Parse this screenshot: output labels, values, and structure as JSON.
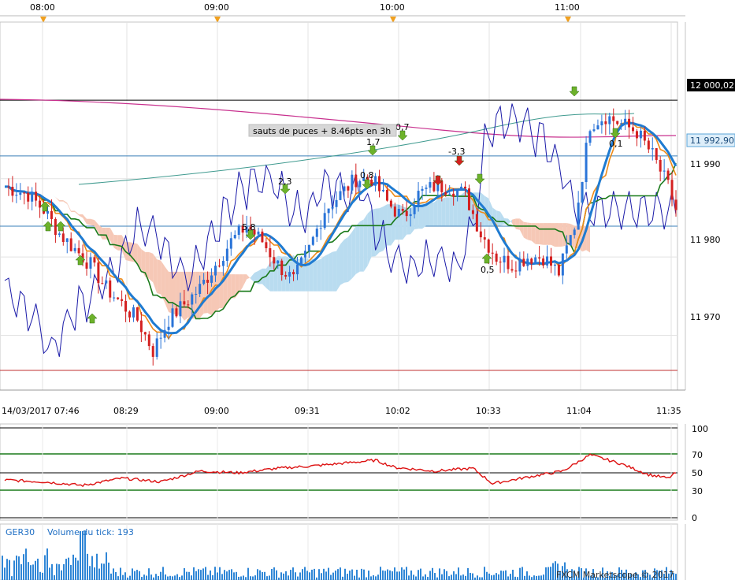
{
  "top_times": [
    "08:00",
    "09:00",
    "10:00",
    "11:00"
  ],
  "colors": {
    "candle_up": "#2a74d8",
    "candle_down": "#d42020",
    "cloud_bull": "#b9dcf0",
    "cloud_bear": "#f6c8b6",
    "sma_blue": "#1f7bd1",
    "tenkan": "#ee8a17",
    "kijun": "#1a7a1a",
    "magenta": "#c8308e",
    "teal": "#3f9a8f",
    "chikou": "#1a1aa8",
    "rsi": "#dd1111",
    "rsi_band": "#1a7a1a",
    "volume": "#2f86d6"
  },
  "price_panel": {
    "y_ticks": [
      "11 990",
      "11 980",
      "11 970"
    ],
    "price_tags": [
      {
        "text": "12 000,02",
        "style": "dark"
      },
      {
        "text": "11 992,90",
        "style": "light"
      }
    ],
    "annotation": "sauts de puces + 8.46pts en 3h",
    "signal_labels": [
      "5,8",
      "2,3",
      "0,8",
      "1,7",
      "0,7",
      "-3,3",
      "0,5",
      "0,1"
    ]
  },
  "time_axis": [
    "14/03/2017 07:46",
    "08:29",
    "09:00",
    "09:31",
    "10:02",
    "10:33",
    "11:04",
    "11:35"
  ],
  "rsi_panel": {
    "levels": [
      "100",
      "70",
      "50",
      "30",
      "0"
    ]
  },
  "volume_panel": {
    "symbol": "GER30",
    "label": "Volume du tick: 193",
    "brand": "FXCM Marketscope © 2017"
  },
  "chart_data": {
    "type": "candlestick",
    "instrument": "GER30",
    "x_start": "14/03/2017 07:46",
    "x_end": "11:35",
    "ylim": [
      11963,
      12010
    ],
    "y_ticks": [
      11970,
      11980,
      11990
    ],
    "horizontal_levels": [
      12000.02,
      11992.9
    ],
    "approx_close_path": [
      [
        0,
        11989
      ],
      [
        6,
        11988
      ],
      [
        10,
        11986
      ],
      [
        14,
        11983
      ],
      [
        18,
        11981
      ],
      [
        22,
        11979
      ],
      [
        26,
        11976
      ],
      [
        30,
        11974
      ],
      [
        34,
        11972
      ],
      [
        38,
        11968
      ],
      [
        42,
        11972
      ],
      [
        46,
        11974
      ],
      [
        50,
        11976
      ],
      [
        54,
        11979
      ],
      [
        58,
        11982
      ],
      [
        62,
        11984
      ],
      [
        66,
        11982
      ],
      [
        70,
        11979
      ],
      [
        74,
        11977
      ],
      [
        78,
        11981
      ],
      [
        82,
        11986
      ],
      [
        86,
        11988
      ],
      [
        90,
        11990
      ],
      [
        94,
        11990
      ],
      [
        98,
        11987
      ],
      [
        102,
        11985
      ],
      [
        106,
        11988
      ],
      [
        110,
        11989
      ],
      [
        114,
        11989
      ],
      [
        118,
        11988
      ],
      [
        122,
        11983
      ],
      [
        126,
        11980
      ],
      [
        130,
        11979
      ],
      [
        134,
        11980
      ],
      [
        138,
        11980
      ],
      [
        142,
        11978
      ],
      [
        146,
        11984
      ],
      [
        150,
        11997
      ],
      [
        154,
        11998
      ],
      [
        158,
        11997
      ],
      [
        162,
        11996
      ],
      [
        166,
        11993
      ],
      [
        170,
        11989
      ],
      [
        172,
        11986
      ]
    ],
    "rsi": {
      "levels": [
        100,
        70,
        50,
        30,
        0
      ],
      "approx": [
        [
          0,
          42
        ],
        [
          10,
          40
        ],
        [
          20,
          36
        ],
        [
          30,
          44
        ],
        [
          40,
          40
        ],
        [
          50,
          52
        ],
        [
          60,
          50
        ],
        [
          70,
          55
        ],
        [
          80,
          58
        ],
        [
          90,
          62
        ],
        [
          95,
          64
        ],
        [
          100,
          56
        ],
        [
          110,
          52
        ],
        [
          120,
          55
        ],
        [
          125,
          38
        ],
        [
          135,
          46
        ],
        [
          143,
          52
        ],
        [
          150,
          70
        ],
        [
          158,
          60
        ],
        [
          165,
          48
        ],
        [
          170,
          44
        ],
        [
          172,
          50
        ]
      ]
    },
    "volume_last_tick": 193
  }
}
